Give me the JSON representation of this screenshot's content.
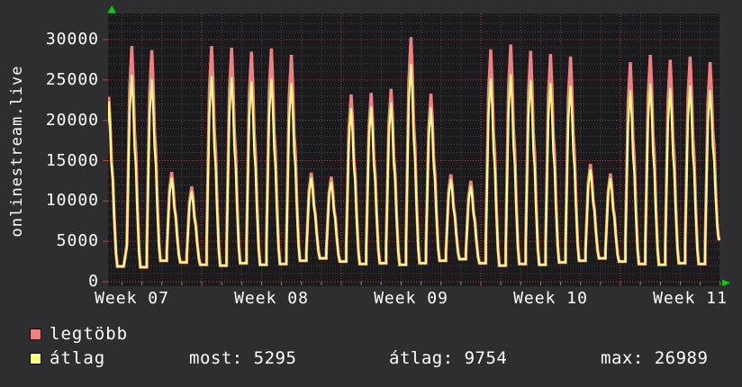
{
  "title_vertical": "onlinestream.live",
  "legend": [
    {
      "label": "legtöbb",
      "color": "#f08080"
    },
    {
      "label": "átlag",
      "color": "#ffff7d"
    }
  ],
  "stats": [
    {
      "label": "most",
      "value": "5295"
    },
    {
      "label": "átlag",
      "value": "9754"
    },
    {
      "label": "max",
      "value": "26989"
    }
  ],
  "colors": {
    "page_bg": "#2e2e30",
    "plot_bg": "#1b1b1d",
    "minor_grid": "#47474a",
    "major_grid": "#b03a3a",
    "axis_line": "#c24040",
    "arrow_green": "#00d400",
    "text": "#ffffff",
    "series_max": "#f08080",
    "series_avg": "#ffff7d"
  },
  "chart_data": {
    "type": "line",
    "title": "onlinestream.live",
    "ylabel": "onlinestream.live",
    "grid": "on",
    "legend_position": "bottom-left",
    "y_axis": {
      "ticks": [
        0,
        5000,
        10000,
        15000,
        20000,
        25000,
        30000
      ],
      "minor_step": 1000,
      "range": [
        0,
        33300
      ]
    },
    "x_axis": {
      "tick_labels": [
        "Week 07",
        "Week 08",
        "Week 09",
        "Week 10",
        "Week 11"
      ],
      "unit": "weeks, daily oscillation"
    },
    "series": [
      {
        "name": "legtöbb",
        "color": "#f08080",
        "daily_peaks": [
          22900,
          29200,
          28700,
          13600,
          11800,
          29200,
          29000,
          28500,
          28900,
          28100,
          13500,
          13000,
          23200,
          23400,
          23900,
          30300,
          23300,
          13300,
          12500,
          28800,
          29400,
          28600,
          28200,
          27900,
          14600,
          13400,
          27200,
          28100,
          27500,
          27900,
          27200
        ]
      },
      {
        "name": "átlag",
        "color": "#ffff7d",
        "daily_peaks": [
          22300,
          25600,
          25100,
          12900,
          11200,
          25500,
          25300,
          24800,
          25200,
          24600,
          12900,
          12400,
          21500,
          21700,
          22200,
          26989,
          21600,
          12700,
          11900,
          25200,
          25700,
          25000,
          24600,
          24300,
          13900,
          12800,
          23700,
          24500,
          24000,
          24300,
          23700
        ]
      }
    ],
    "daily_troughs": [
      2400,
      1900,
      1800,
      2600,
      2400,
      2100,
      2000,
      2300,
      2100,
      2200,
      2600,
      2900,
      2500,
      2200,
      2300,
      2100,
      2300,
      2600,
      2800,
      2300,
      2000,
      2200,
      2100,
      2400,
      2600,
      2900,
      2500,
      2200,
      2100,
      2300,
      2200,
      5295
    ],
    "stats": {
      "most": 5295,
      "atlag": 9754,
      "max": 26989
    }
  }
}
